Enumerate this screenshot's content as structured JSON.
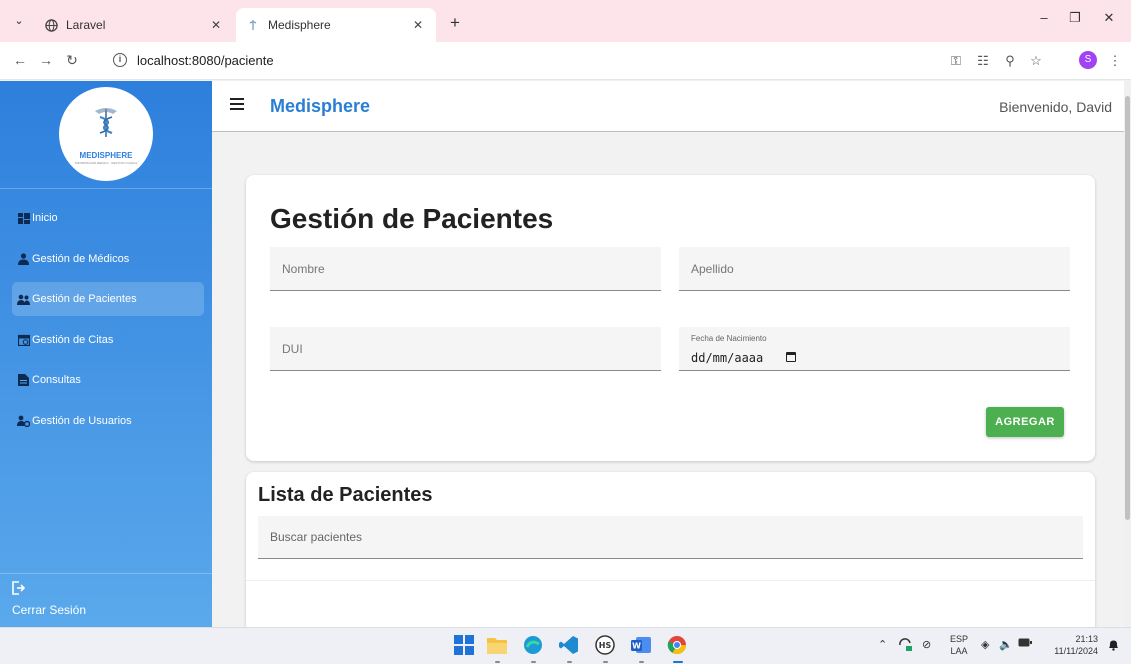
{
  "browser": {
    "tabs": [
      {
        "title": "Laravel",
        "active": false
      },
      {
        "title": "Medisphere",
        "active": true
      }
    ],
    "new_tab": "+",
    "url": "localhost:8080/paciente",
    "profile_initial": "S"
  },
  "sidebar": {
    "logo_text": "MEDISPHERE",
    "logo_subtext": "INFORMACION MEDICA · GESTION CLINICA",
    "items": [
      {
        "label": "Inicio",
        "icon": "dashboard-icon",
        "active": false
      },
      {
        "label": "Gestión de Médicos",
        "icon": "doctor-icon",
        "active": false
      },
      {
        "label": "Gestión de Pacientes",
        "icon": "patients-icon",
        "active": true
      },
      {
        "label": "Gestión de Citas",
        "icon": "calendar-icon",
        "active": false
      },
      {
        "label": "Consultas",
        "icon": "document-icon",
        "active": false
      },
      {
        "label": "Gestión de Usuarios",
        "icon": "users-gear-icon",
        "active": false
      }
    ],
    "logout": "Cerrar Sesión"
  },
  "header": {
    "brand": "Medisphere",
    "welcome": "Bienvenido, David"
  },
  "form": {
    "title": "Gestión de Pacientes",
    "nombre_placeholder": "Nombre",
    "apellido_placeholder": "Apellido",
    "dui_placeholder": "DUI",
    "fecha_label": "Fecha de Nacimiento",
    "fecha_value": "dd/mm/aaaa",
    "submit": "AGREGAR"
  },
  "list": {
    "title": "Lista de Pacientes",
    "search_placeholder": "Buscar pacientes"
  },
  "taskbar": {
    "lang_top": "ESP",
    "lang_bottom": "LAA",
    "time": "21:13",
    "date": "11/11/2024"
  },
  "colors": {
    "brand": "#2a7fd4",
    "sidebar_top": "#2d7fdc",
    "sidebar_bottom": "#5aa9ec",
    "primary_button": "#4caf50",
    "tabbar": "#fde3ea"
  }
}
